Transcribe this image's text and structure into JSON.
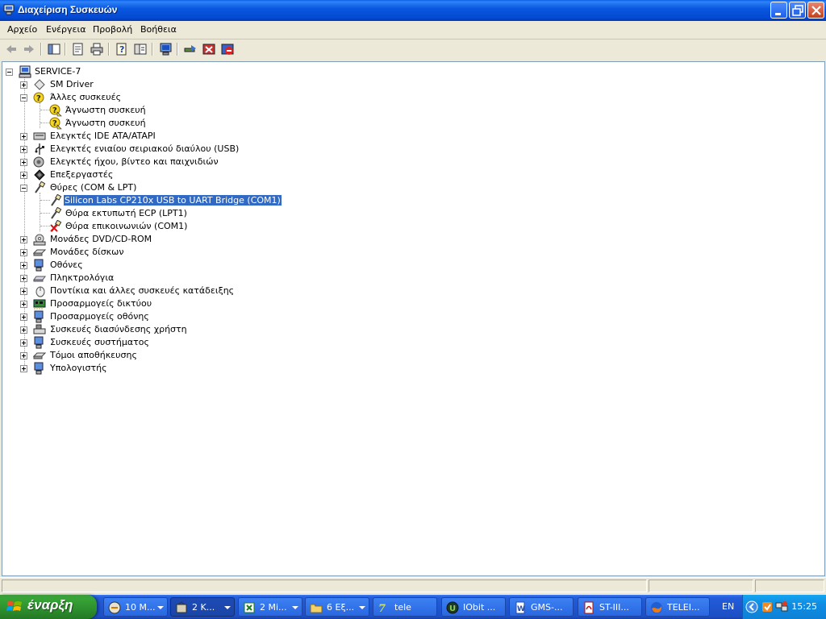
{
  "window": {
    "title": "Διαχείριση Συσκευών"
  },
  "menu": [
    "Αρχείο",
    "Ενέργεια",
    "Προβολή",
    "Βοήθεια"
  ],
  "toolbar": [
    "back-icon",
    "forward-icon",
    "show-hide-console-tree-icon",
    "properties-icon",
    "print-icon",
    "help-icon",
    "export-list-icon",
    "computer-scan-icon",
    "update-driver-icon",
    "uninstall-icon",
    "disable-icon"
  ],
  "tree": {
    "root": "SERVICE-7",
    "items": [
      {
        "label": "SM Driver"
      },
      {
        "label": "Άλλες συσκευές"
      },
      {
        "label": "Άγνωστη συσκευή"
      },
      {
        "label": "Άγνωστη συσκευή"
      },
      {
        "label": "Ελεγκτές IDE ATA/ATAPI"
      },
      {
        "label": "Ελεγκτές ενιαίου σειριακού διαύλου (USB)"
      },
      {
        "label": "Ελεγκτές ήχου, βίντεο και παιχνιδιών"
      },
      {
        "label": "Επεξεργαστές"
      },
      {
        "label": "Θύρες (COM & LPT)"
      },
      {
        "label": "Silicon Labs CP210x USB to UART Bridge (COM1)"
      },
      {
        "label": "Θύρα εκτυπωτή ECP (LPT1)"
      },
      {
        "label": "Θύρα επικοινωνιών (COM1)"
      },
      {
        "label": "Μονάδες DVD/CD-ROM"
      },
      {
        "label": "Μονάδες δίσκων"
      },
      {
        "label": "Οθόνες"
      },
      {
        "label": "Πληκτρολόγια"
      },
      {
        "label": "Ποντίκια και άλλες συσκευές κατάδειξης"
      },
      {
        "label": "Προσαρμογείς δικτύου"
      },
      {
        "label": "Προσαρμογείς οθόνης"
      },
      {
        "label": "Συσκευές διασύνδεσης χρήστη"
      },
      {
        "label": "Συσκευές συστήματος"
      },
      {
        "label": "Τόμοι αποθήκευσης"
      },
      {
        "label": "Υπολογιστής"
      }
    ]
  },
  "taskbar": {
    "start_label": "έναρξη",
    "tasks": [
      {
        "label": "10 M..."
      },
      {
        "label": "2 K..."
      },
      {
        "label": "2 Mi..."
      },
      {
        "label": "6 Εξ..."
      },
      {
        "label": "tele"
      },
      {
        "label": "IObit ..."
      },
      {
        "label": "GMS-..."
      },
      {
        "label": "ST-III..."
      },
      {
        "label": "TELEI..."
      }
    ],
    "language": "EN",
    "clock": "15:25"
  }
}
